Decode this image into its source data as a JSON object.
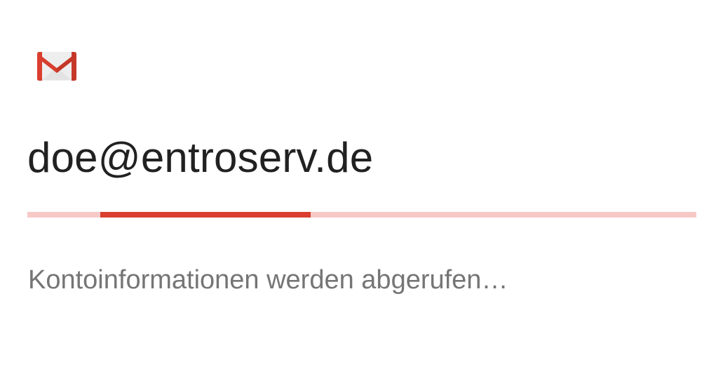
{
  "app": {
    "logo_icon": "gmail-icon",
    "brand_colors": {
      "red": "#d93e2e",
      "dark_red": "#b23121",
      "envelope": "#f2f2f2"
    }
  },
  "account": {
    "email": "doe@entroserv.de"
  },
  "progress": {
    "mode": "indeterminate",
    "indicator_start_fraction": 0.109,
    "indicator_end_fraction": 0.423,
    "track_color": "#f6c9c7",
    "indicator_color": "#d93e2e"
  },
  "status": {
    "message": "Kontoinformationen werden abgerufen…"
  }
}
